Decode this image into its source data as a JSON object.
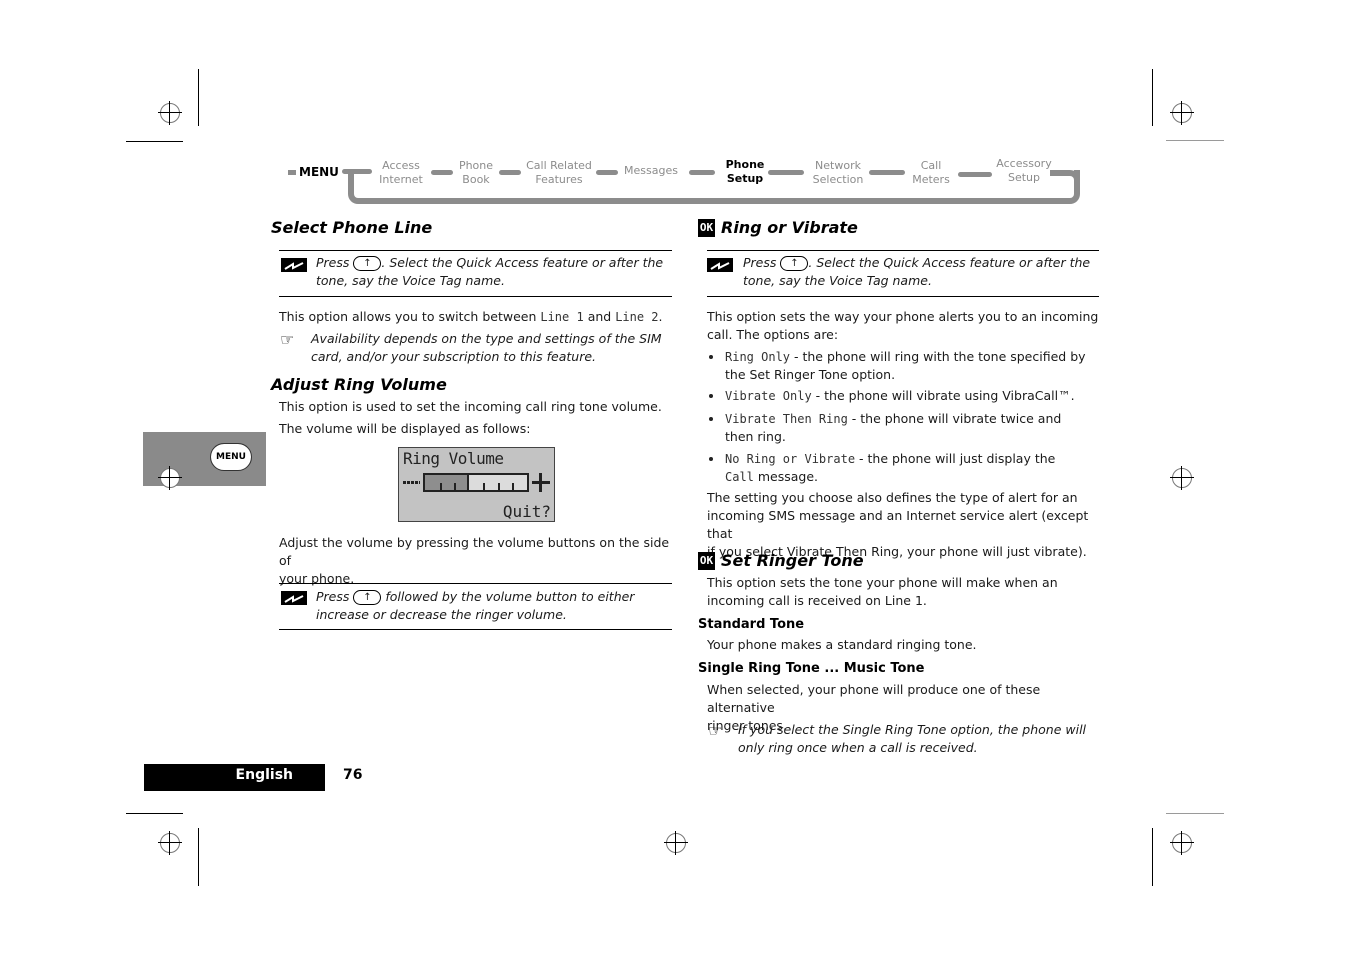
{
  "nav": {
    "menu_label": "MENU",
    "items": [
      {
        "line1": "Access",
        "line2": "Internet",
        "active": false
      },
      {
        "line1": "Phone",
        "line2": "Book",
        "active": false
      },
      {
        "line1": "Call Related",
        "line2": "Features",
        "active": false
      },
      {
        "line1": "Messages",
        "line2": "",
        "active": false
      },
      {
        "line1": "Phone",
        "line2": "Setup",
        "active": true
      },
      {
        "line1": "Network",
        "line2": "Selection",
        "active": false
      },
      {
        "line1": "Call",
        "line2": "Meters",
        "active": false
      },
      {
        "line1": "Accessory",
        "line2": "Setup",
        "active": false
      }
    ]
  },
  "left": {
    "select_phone_line": {
      "title": "Select Phone Line",
      "shortcut": {
        "press": "Press",
        "key_glyph": "↑",
        "rest_line1": ". Select the Quick Access feature or after the",
        "line2": "tone, say the Voice Tag name."
      },
      "body_prefix": "This option allows you to switch between ",
      "line1": "Line 1",
      "and": " and ",
      "line2": "Line 2",
      "period": ".",
      "note_line1": "Availability depends on the type and settings of the SIM",
      "note_line2": "card, and/or your subscription to this feature."
    },
    "adjust_ring_volume": {
      "title": "Adjust Ring Volume",
      "body1": "This option is used to set the incoming call ring tone volume.",
      "body2": "The volume will be displayed as follows:",
      "lcd": {
        "title": "Ring Volume",
        "quit": "Quit?",
        "level_fraction": 0.43,
        "steps": 7,
        "filled_steps": 3
      },
      "body3_line1": "Adjust the volume by pressing the volume buttons on the side of",
      "body3_line2": "your phone.",
      "shortcut": {
        "press": "Press",
        "key_glyph": "↑",
        "rest_line1": " followed by the volume button to either",
        "line2": "increase or decrease the ringer volume."
      }
    }
  },
  "right": {
    "ring_or_vibrate": {
      "badge": "OK",
      "title": "Ring or Vibrate",
      "shortcut": {
        "press": "Press",
        "key_glyph": "↑",
        "rest_line1": ". Select the Quick Access feature or after the",
        "line2": "tone, say the Voice Tag name."
      },
      "intro_line1": "This option sets the way your phone alerts you to an incoming",
      "intro_line2": "call. The options are:",
      "options": [
        {
          "name": "Ring Only",
          "desc_line1": " - the phone will ring with the tone specified by",
          "desc_line2": "the Set Ringer Tone option."
        },
        {
          "name": "Vibrate Only",
          "desc_line1": " - the phone will vibrate using VibraCall™.",
          "desc_line2": ""
        },
        {
          "name": "Vibrate Then Ring",
          "desc_line1": " - the phone will vibrate twice and",
          "desc_line2": "then ring."
        },
        {
          "name": "No Ring or Vibrate",
          "desc_line1": " - the phone will just display the",
          "desc_line2_mono": "Call",
          "desc_line2": " message."
        }
      ],
      "outro_line1": "The setting you choose also defines the type of alert for an",
      "outro_line2": "incoming SMS message and an Internet service alert (except that",
      "outro_line3": "if you select Vibrate Then Ring, your phone will just vibrate)."
    },
    "set_ringer_tone": {
      "badge": "OK",
      "title": "Set Ringer Tone",
      "body_line1": "This option sets the tone your phone will make when an",
      "body_line2": "incoming call is received on Line 1.",
      "standard_title": "Standard Tone",
      "standard_body": "Your phone makes a standard ringing tone.",
      "single_title": "Single Ring Tone ... Music Tone",
      "single_body_line1": "When selected, your phone will produce one of these alternative",
      "single_body_line2": "ringer tones.",
      "note_line1": "If you select the Single Ring Tone option, the phone will",
      "note_line2": "only ring once when a call is received."
    }
  },
  "side_tab": {
    "button_label": "MENU"
  },
  "footer": {
    "language": "English",
    "page_number": "76"
  },
  "icons": {
    "note": "☞",
    "shortcut": "quick-access-icon"
  }
}
